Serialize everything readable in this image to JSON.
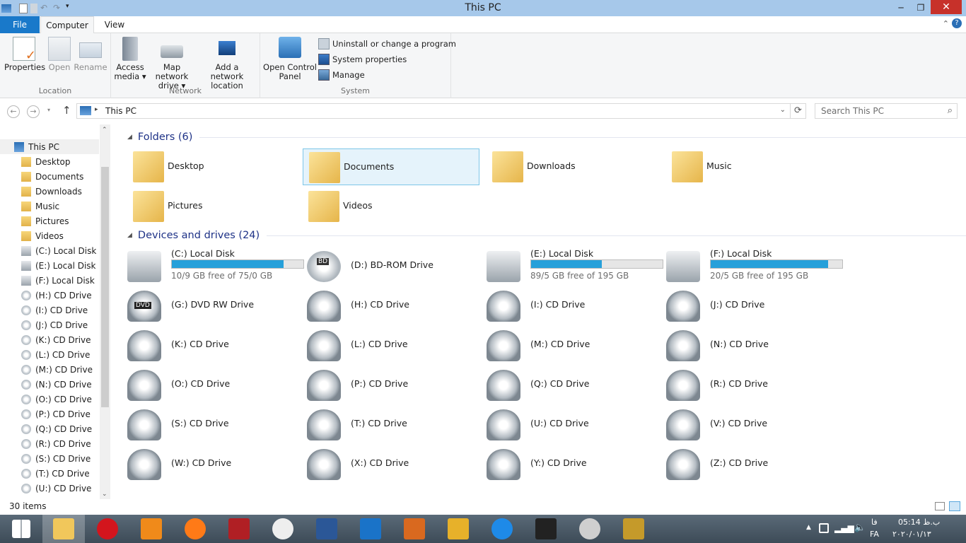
{
  "window": {
    "title": "This PC",
    "minimize": "─",
    "maximize": "❐",
    "close": "✕"
  },
  "tabs": {
    "file": "File",
    "computer": "Computer",
    "view": "View"
  },
  "ribbon": {
    "location": {
      "label": "Location",
      "properties": "Properties",
      "open": "Open",
      "rename": "Rename"
    },
    "network": {
      "label": "Network",
      "access_media_1": "Access",
      "access_media_2": "media ▾",
      "map_drive_1": "Map network",
      "map_drive_2": "drive ▾",
      "add_location_1": "Add a network",
      "add_location_2": "location"
    },
    "system": {
      "label": "System",
      "control_panel_1": "Open Control",
      "control_panel_2": "Panel",
      "uninstall": "Uninstall or change a program",
      "system_properties": "System properties",
      "manage": "Manage"
    }
  },
  "address": {
    "path": "This PC",
    "search_placeholder": "Search This PC"
  },
  "sidebar": {
    "root": "This PC",
    "items": [
      "Desktop",
      "Documents",
      "Downloads",
      "Music",
      "Pictures",
      "Videos",
      "(C:) Local Disk",
      "(E:) Local Disk",
      "(F:) Local Disk",
      "(H:) CD Drive",
      "(I:) CD Drive",
      "(J:) CD Drive",
      "(K:) CD Drive",
      "(L:) CD Drive",
      "(M:) CD Drive",
      "(N:) CD Drive",
      "(O:) CD Drive",
      "(P:) CD Drive",
      "(Q:) CD Drive",
      "(R:) CD Drive",
      "(S:) CD Drive",
      "(T:) CD Drive",
      "(U:) CD Drive"
    ]
  },
  "folders": {
    "header": "Folders (6)",
    "items": [
      "Desktop",
      "Documents",
      "Downloads",
      "Music",
      "Pictures",
      "Videos"
    ]
  },
  "drives": {
    "header": "Devices and drives (24)",
    "disks": [
      {
        "name": "(C:) Local Disk",
        "free": "10/9 GB free of 75/0 GB",
        "used_fraction": 0.85
      },
      {
        "name": "(D:) BD-ROM Drive"
      },
      {
        "name": "(E:) Local Disk",
        "free": "89/5 GB free of 195 GB",
        "used_fraction": 0.54
      },
      {
        "name": "(F:) Local Disk",
        "free": "20/5 GB free of 195 GB",
        "used_fraction": 0.89
      }
    ],
    "cd": [
      "(G:) DVD RW Drive",
      "(H:) CD Drive",
      "(I:) CD Drive",
      "(J:) CD Drive",
      "(K:) CD Drive",
      "(L:) CD Drive",
      "(M:) CD Drive",
      "(N:) CD Drive",
      "(O:) CD Drive",
      "(P:) CD Drive",
      "(Q:) CD Drive",
      "(R:) CD Drive",
      "(S:) CD Drive",
      "(T:) CD Drive",
      "(U:) CD Drive",
      "(V:) CD Drive",
      "(W:) CD Drive",
      "(X:) CD Drive",
      "(Y:) CD Drive",
      "(Z:) CD Drive"
    ],
    "bd_badge": "BD",
    "dvd_badge": "DVD"
  },
  "status": {
    "items": "30 items"
  },
  "taskbar": {
    "apps": [
      "start-icon",
      "file-explorer-icon",
      "opera-icon",
      "media-player-icon",
      "firefox-icon",
      "age-of-empires-icon",
      "incognito-icon",
      "word-icon",
      "pen-tool-icon",
      "filezilla-icon",
      "sketch-icon",
      "sync-icon",
      "nox-icon",
      "counter-strike-icon",
      "counter-strike-2-icon"
    ],
    "time": "05:14 ب.ظ",
    "date": "۲۰۲۰/۰۱/۱۳",
    "lang": "FA",
    "lang2": "فا"
  }
}
